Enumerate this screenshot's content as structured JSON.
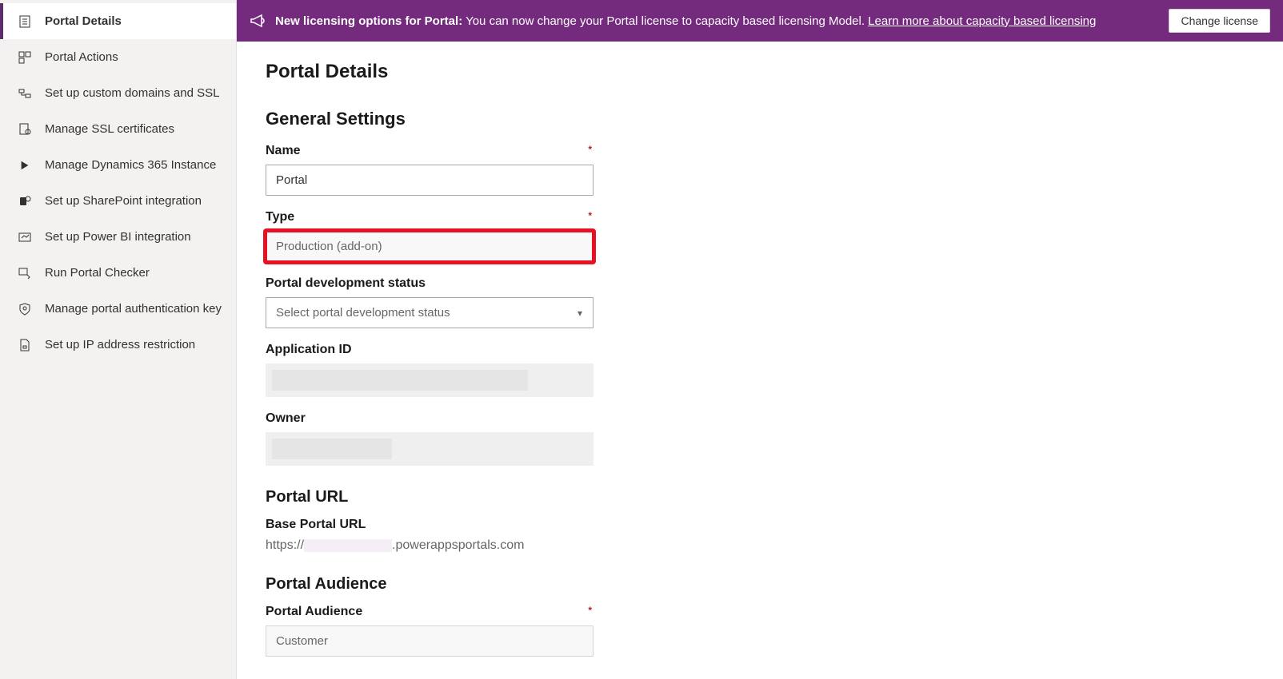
{
  "banner": {
    "bold_text": "New licensing options for Portal:",
    "text": " You can now change your Portal license to capacity based licensing Model. ",
    "link_text": "Learn more about capacity based licensing",
    "button_label": "Change license"
  },
  "sidebar": {
    "items": [
      {
        "label": "Portal Details",
        "icon": "document-icon"
      },
      {
        "label": "Portal Actions",
        "icon": "actions-icon"
      },
      {
        "label": "Set up custom domains and SSL",
        "icon": "domain-icon"
      },
      {
        "label": "Manage SSL certificates",
        "icon": "certificate-icon"
      },
      {
        "label": "Manage Dynamics 365 Instance",
        "icon": "play-icon"
      },
      {
        "label": "Set up SharePoint integration",
        "icon": "sharepoint-icon"
      },
      {
        "label": "Set up Power BI integration",
        "icon": "chart-icon"
      },
      {
        "label": "Run Portal Checker",
        "icon": "checker-icon"
      },
      {
        "label": "Manage portal authentication key",
        "icon": "shield-icon"
      },
      {
        "label": "Set up IP address restriction",
        "icon": "file-lock-icon"
      }
    ]
  },
  "page": {
    "title": "Portal Details",
    "general_settings_title": "General Settings",
    "name_label": "Name",
    "name_value": "Portal",
    "type_label": "Type",
    "type_value": "Production (add-on)",
    "dev_status_label": "Portal development status",
    "dev_status_placeholder": "Select portal development status",
    "app_id_label": "Application ID",
    "owner_label": "Owner",
    "portal_url_title": "Portal URL",
    "base_url_label": "Base Portal URL",
    "url_prefix": "https://",
    "url_suffix": ".powerappsportals.com",
    "portal_audience_title": "Portal Audience",
    "portal_audience_label": "Portal Audience",
    "portal_audience_value": "Customer"
  }
}
